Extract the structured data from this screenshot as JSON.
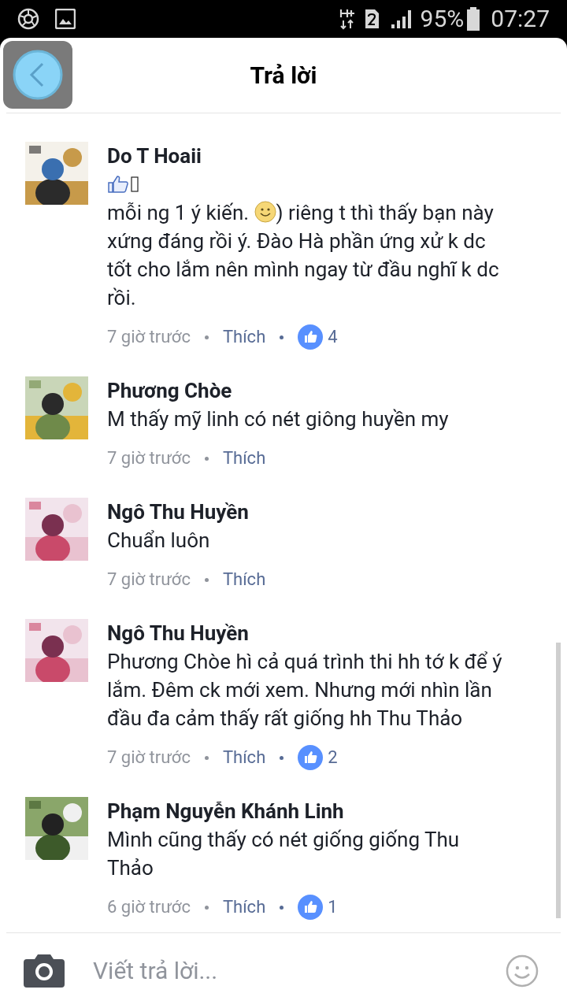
{
  "status_bar": {
    "battery": "95%",
    "time": "07:27"
  },
  "header": {
    "title": "Trả lời"
  },
  "comments": [
    {
      "author": "Do T Hoaii",
      "emoji_line": [
        {
          "kind": "thumbs"
        },
        {
          "kind": "missing_glyph"
        }
      ],
      "body": [
        {
          "kind": "text",
          "text": "mỗi ng 1 ý kiến. "
        },
        {
          "kind": "emoji"
        },
        {
          "kind": "text",
          "text": ") riêng t thì thấy bạn này xứng đáng rồi ý. Đào Hà phần ứng xử k dc tốt cho lắm nên mình ngay từ đầu nghĩ k dc rồi."
        }
      ],
      "time": "7 giờ trước",
      "like": "Thích",
      "likes": "4"
    },
    {
      "author": "Phương Chòe",
      "body": [
        {
          "kind": "text",
          "text": "M thấy mỹ linh có nét giông huyền my"
        }
      ],
      "time": "7 giờ trước",
      "like": "Thích"
    },
    {
      "author": "Ngô Thu Huyền",
      "body": [
        {
          "kind": "text",
          "text": "Chuẩn luôn"
        }
      ],
      "time": "7 giờ trước",
      "like": "Thích"
    },
    {
      "author": "Ngô Thu Huyền",
      "body": [
        {
          "kind": "text",
          "text": "Phương Chòe hì cả quá trình thi hh tớ k để ý lắm. Đêm ck mới xem. Nhưng mới nhìn lần đầu đa cảm thấy rất giống hh Thu Thảo"
        }
      ],
      "time": "7 giờ trước",
      "like": "Thích",
      "likes": "2"
    },
    {
      "author": "Phạm Nguyễn Khánh Linh",
      "body": [
        {
          "kind": "text",
          "text": "Mình cũng thấy có nét giống giống Thu Thảo"
        }
      ],
      "time": "6 giờ trước",
      "like": "Thích",
      "likes": "1"
    }
  ],
  "composer": {
    "placeholder": "Viết trả lời..."
  }
}
